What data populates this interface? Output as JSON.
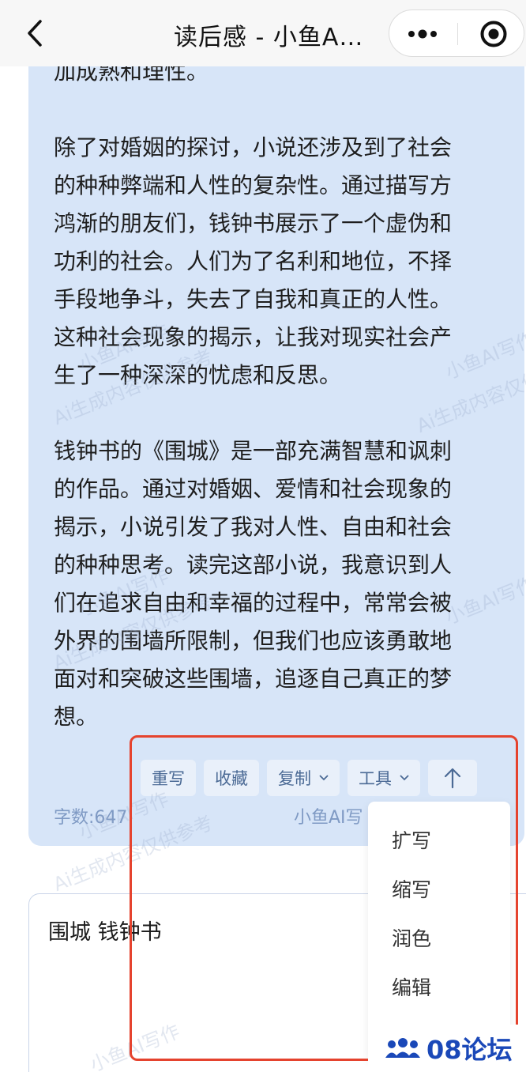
{
  "nav": {
    "title": "读后感 - 小鱼A…"
  },
  "answer": {
    "partial_line": "加成熟和理性。",
    "paragraphs": [
      [
        "除了对婚姻的探讨，小说还涉及到了社会",
        "的种种弊端和人性的复杂性。通过描写方",
        "鸿渐的朋友们，钱钟书展示了一个虚伪和",
        "功利的社会。人们为了名利和地位，不择",
        "手段地争斗，失去了自我和真正的人性。",
        "这种社会现象的揭示，让我对现实社会产",
        "生了一种深深的忧虑和反思。"
      ],
      [
        "钱钟书的《围城》是一部充满智慧和讽刺",
        "的作品。通过对婚姻、爱情和社会现象的",
        "揭示，小说引发了我对人性、自由和社会",
        "的种种思考。读完这部小说，我意识到人",
        "们在追求自由和幸福的过程中，常常会被",
        "外界的围墙所限制，但我们也应该勇敢地",
        "面对和突破这些围墙，追逐自己真正的梦",
        "想。"
      ]
    ],
    "actions": {
      "rewrite": "重写",
      "favorite": "收藏",
      "copy": "复制",
      "tools": "工具"
    },
    "word_count": "字数:647",
    "brand": "小鱼AI写"
  },
  "tools_menu": {
    "items": [
      "扩写",
      "缩写",
      "润色",
      "编辑"
    ]
  },
  "input": {
    "value": "围城 钱钟书"
  },
  "watermarks": {
    "line1": "小鱼AI写作",
    "line2": "Ai生成内容仅供参考"
  },
  "site_badge": {
    "text": "08论坛"
  },
  "colors": {
    "card_bg": "#d7e5f8",
    "button_text": "#4b6a95",
    "highlight": "#e5432e",
    "badge": "#1a48b8"
  }
}
